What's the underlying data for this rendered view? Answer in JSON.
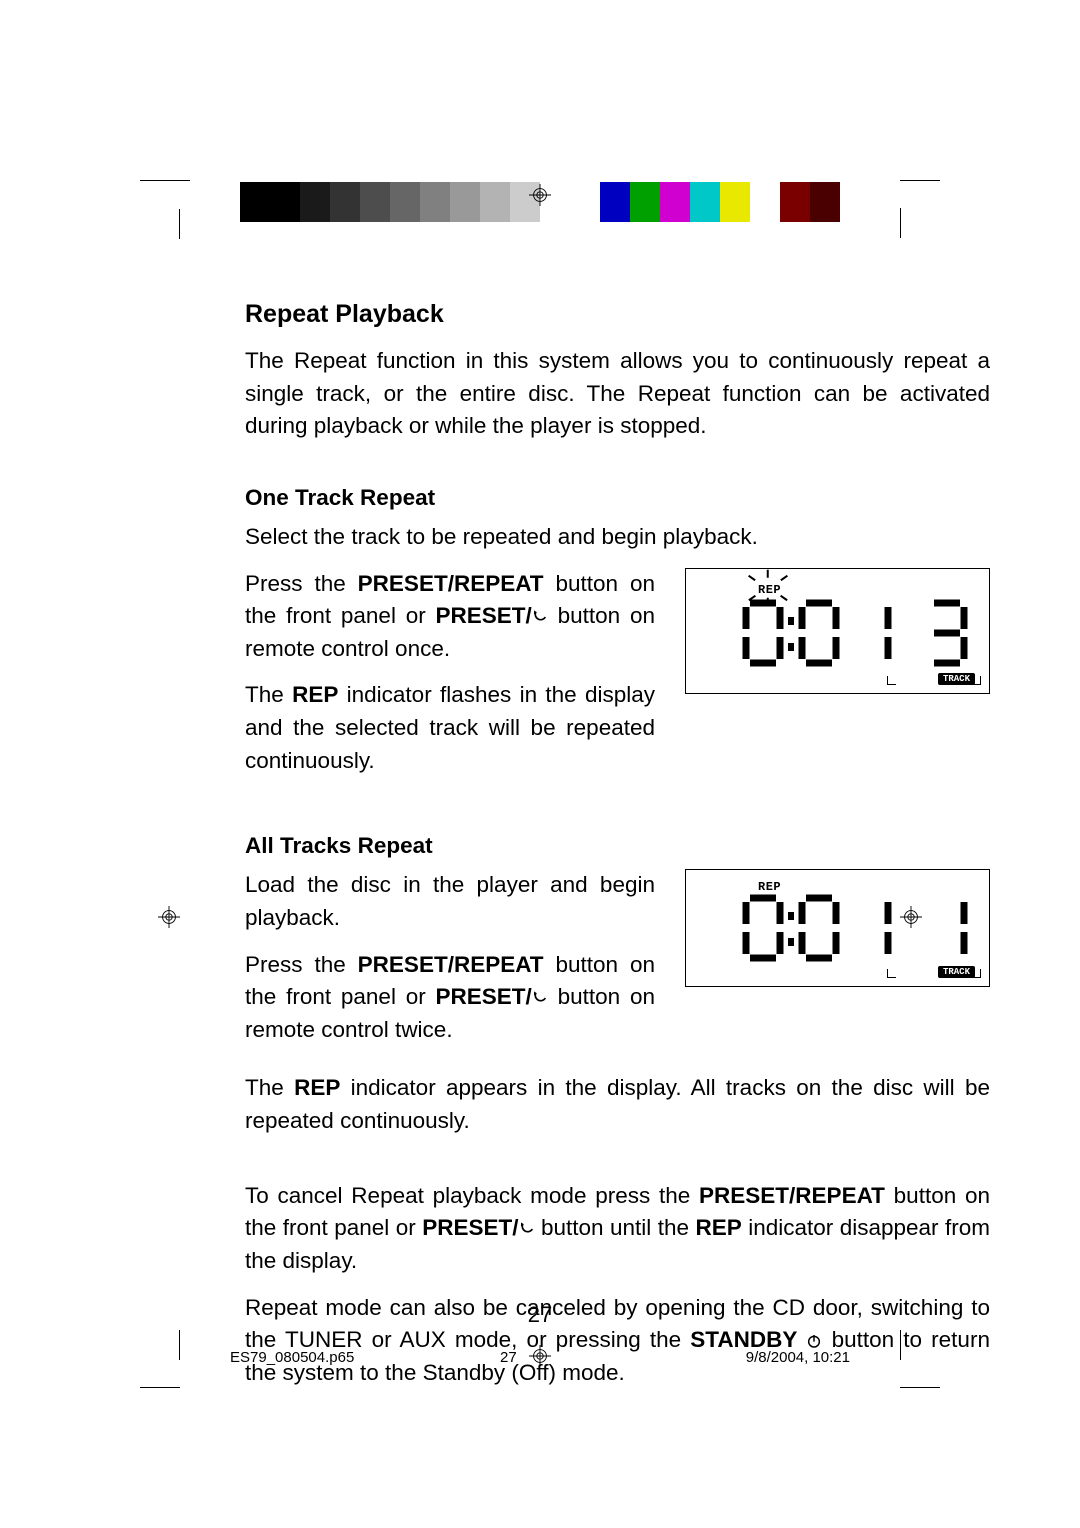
{
  "colorbar": [
    "#000000",
    "#000000",
    "#1a1a1a",
    "#333333",
    "#4d4d4d",
    "#666666",
    "#808080",
    "#999999",
    "#b3b3b3",
    "#cccccc",
    "#ffffff",
    "#ffffff",
    "#0000c0",
    "#00a000",
    "#d000d0",
    "#00c8c8",
    "#e8e800",
    "#ffffff",
    "#7a0000",
    "#4a0000"
  ],
  "section": {
    "title": "Repeat Playback",
    "intro": "The Repeat function in this system allows you to continuously repeat a single track, or the entire disc. The Repeat function can be activated during playback or while the player is stopped."
  },
  "one_track": {
    "heading": "One Track Repeat",
    "p1": "Select the track to be repeated and begin playback.",
    "p2a": "Press the ",
    "p2b": "PRESET/REPEAT",
    "p2c": " button on the front panel or ",
    "p2d": "PRESET/",
    "p2e": " button on remote control once.",
    "p3a": "The ",
    "p3b": "REP",
    "p3c": " indicator flashes in the display and the selected track will be repeated continuously.",
    "lcd": {
      "rep": "REP",
      "time": "0:0 1",
      "track_num": "3",
      "track_label": "TRACK"
    }
  },
  "all_tracks": {
    "heading": "All Tracks Repeat",
    "p1": "Load the disc in the player and begin playback.",
    "p2a": "Press the ",
    "p2b": "PRESET/REPEAT",
    "p2c": " button on the front panel or ",
    "p2d": "PRESET/",
    "p2e": " button on remote control twice.",
    "p3a": "The ",
    "p3b": "REP",
    "p3c": " indicator appears in the display. All tracks on the disc will be repeated continuously.",
    "lcd": {
      "rep": "REP",
      "time": "0:0 1",
      "track_num": "1",
      "track_label": "TRACK"
    }
  },
  "cancel": {
    "p1a": "To cancel Repeat playback mode press the ",
    "p1b": "PRESET/REPEAT",
    "p1c": " button on the front panel or ",
    "p1d": "PRESET/",
    "p1e": " button until the ",
    "p1f": "REP",
    "p1g": " indicator disappear from the display.",
    "p2a": "Repeat mode can also be canceled by opening the CD door, switching to the TUNER or AUX mode, or pressing the ",
    "p2b": "STANDBY",
    "p2c": " button to return the system to the Standby (Off) mode."
  },
  "page_number": "27",
  "footer": {
    "file": "ES79_080504.p65",
    "page": "27",
    "datetime": "9/8/2004, 10:21"
  }
}
